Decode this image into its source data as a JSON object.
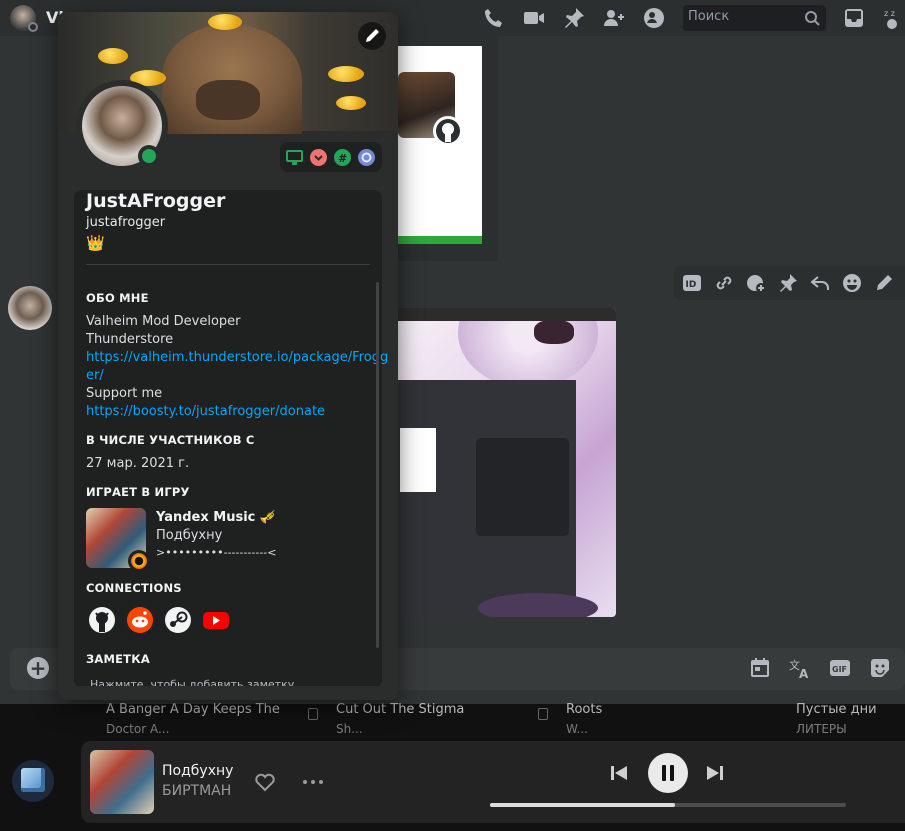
{
  "header": {
    "channel_initial": "Vl",
    "search_placeholder": "Поиск",
    "icons": [
      "call-icon",
      "video-icon",
      "pin-icon",
      "add-member-icon",
      "member-list-icon",
      "inbox-icon",
      "sleep-icon"
    ]
  },
  "message_toolbar": {
    "icons": [
      "copy-id-icon",
      "copy-link-icon",
      "reaction-add-icon",
      "pin-icon",
      "reply-icon",
      "emoji-icon",
      "edit-icon"
    ]
  },
  "composer": {
    "icons": [
      "attach-icon",
      "schedule-icon",
      "translate-icon",
      "gif-icon",
      "sticker-icon"
    ],
    "attach_symbol": "+"
  },
  "profile": {
    "display_name": "JustAFrogger",
    "username": "justafrogger",
    "custom_status": "👑",
    "status": "online",
    "badges": [
      "active-developer-badge",
      "nitro-boost-badge",
      "hashtag-badge",
      "quest-badge"
    ],
    "about": {
      "title": "ОБО МНЕ",
      "line1": "Valheim Mod  Developer",
      "line2": "Thunderstore",
      "link1_a": "https://valheim.thunderstore.io/package/Frogg",
      "link1_b": "er/",
      "line3": "Support me",
      "link2": "https://boosty.to/justafrogger/donate"
    },
    "member_since": {
      "title": "В ЧИСЛЕ УЧАСТНИКОВ С",
      "date": "27 мар. 2021 г."
    },
    "activity": {
      "title": "ИГРАЕТ В ИГРУ",
      "name": "Yandex Music 🎺",
      "details": "Подбухну",
      "state": ">•••••••••-----------<"
    },
    "connections": {
      "title": "CONNECTIONS",
      "items": [
        "github-icon",
        "reddit-icon",
        "steam-icon",
        "youtube-icon"
      ]
    },
    "note": {
      "title": "ЗАМЕТКА",
      "placeholder": "Нажмите, чтобы добавить заметку"
    }
  },
  "music_dock": {
    "tracklist": [
      {
        "title": "A Banger A Day Keeps The",
        "sub": "Doctor A..."
      },
      {
        "title": "Cut Out The Stigma",
        "sub": "Sh..."
      },
      {
        "title": "Roots",
        "sub": "W..."
      },
      {
        "title": "Пустые дни",
        "sub": "ЛИТЕРЫ"
      }
    ],
    "now_playing": {
      "title": "Подбухну",
      "artist": "БИРТМАН",
      "progress_percent": 52
    }
  },
  "colors": {
    "online": "#23a55a",
    "link": "#00a8fc",
    "accent_green": "#2fa83a"
  }
}
